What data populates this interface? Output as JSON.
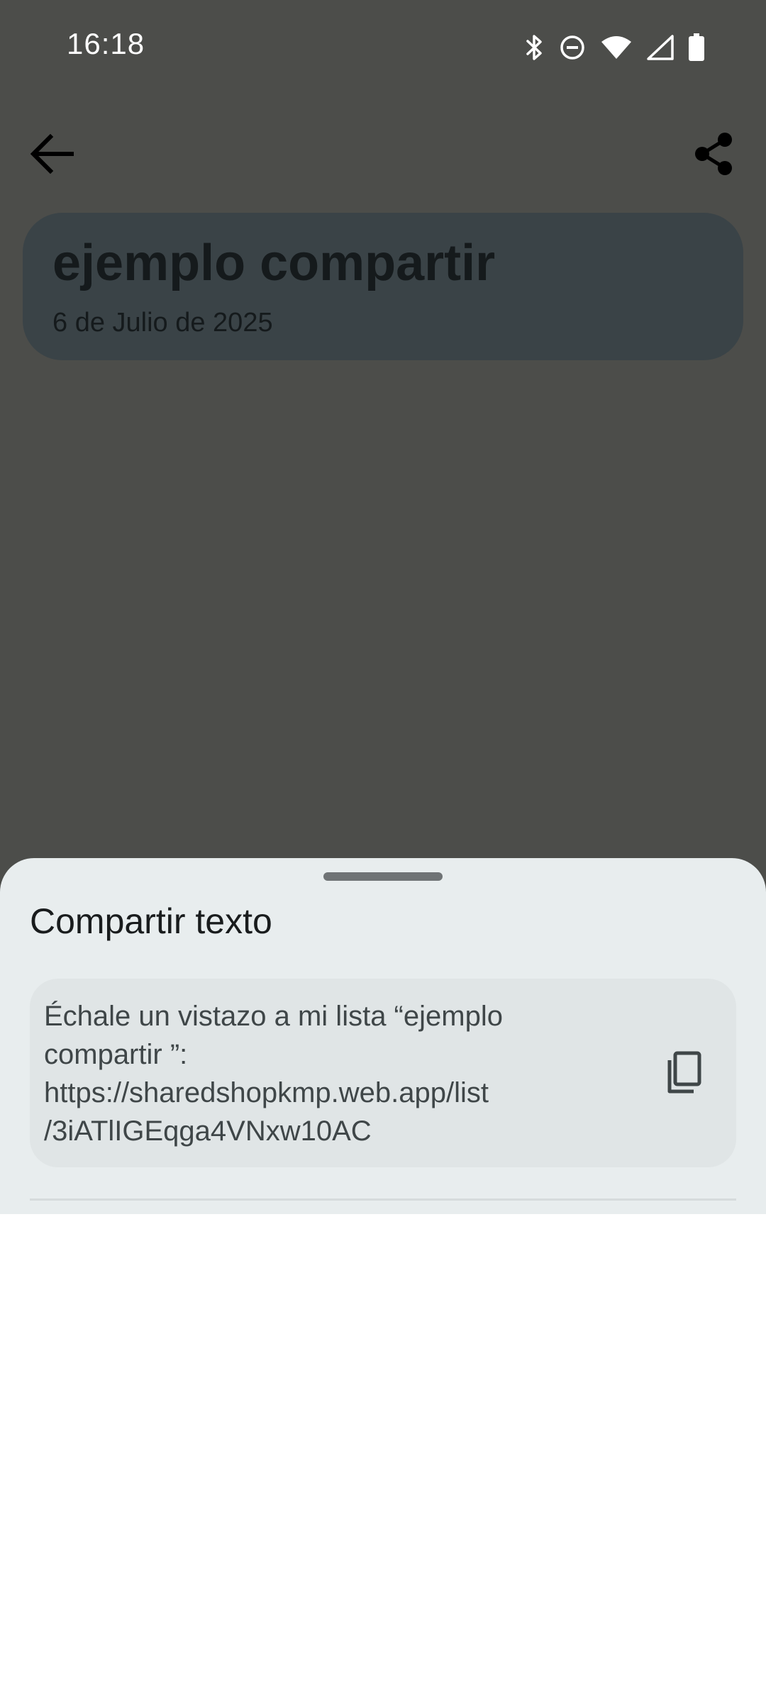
{
  "status_bar": {
    "time": "16:18",
    "icons": [
      "bluetooth-icon",
      "do-not-disturb-icon",
      "wifi-icon",
      "cell-signal-icon",
      "battery-icon"
    ]
  },
  "toolbar": {
    "back_icon": "arrow-back-icon",
    "share_icon": "share-icon"
  },
  "list_card": {
    "title": "ejemplo compartir",
    "date": "6 de Julio de 2025"
  },
  "share_sheet": {
    "title": "Compartir texto",
    "text_lines": [
      "Échale un vistazo a mi lista “ejemplo",
      "compartir ”:",
      "https://sharedshopkmp.web.app/list",
      "/3iATlIGEqga4VNxw10AC"
    ],
    "copy_icon": "copy-icon"
  },
  "colors": {
    "scrim_background": "#4c4d4a",
    "card_background": "#3a4347",
    "sheet_background": "#e8edee",
    "text_box_background": "#e0e5e6"
  }
}
